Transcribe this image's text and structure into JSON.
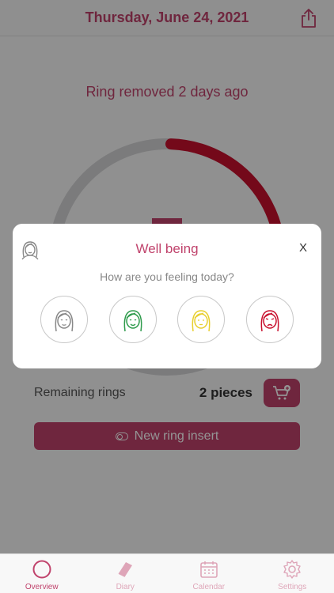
{
  "header": {
    "date": "Thursday, June 24, 2021",
    "share_icon": "share-icon"
  },
  "ring": {
    "status_text": "Ring removed 2 days ago",
    "progress_fraction": 0.28,
    "accent_color": "#c0436c",
    "progress_color": "#c8102e"
  },
  "remaining": {
    "label": "Remaining rings",
    "value": "2 pieces",
    "cart_icon": "cart-add-icon"
  },
  "new_ring": {
    "label": "New ring insert",
    "icon": "toggle-icon"
  },
  "modal": {
    "title": "Well being",
    "subtitle": "How are you feeling today?",
    "close_label": "X",
    "moods": [
      {
        "name": "neutral",
        "color": "#888888"
      },
      {
        "name": "good",
        "color": "#2e9b4c"
      },
      {
        "name": "okay",
        "color": "#e8cf2e"
      },
      {
        "name": "bad",
        "color": "#c8102e"
      }
    ]
  },
  "tabs": [
    {
      "label": "Overview",
      "icon": "ring-icon",
      "active": true
    },
    {
      "label": "Diary",
      "icon": "book-icon",
      "active": false
    },
    {
      "label": "Calendar",
      "icon": "calendar-icon",
      "active": false
    },
    {
      "label": "Settings",
      "icon": "gear-icon",
      "active": false
    }
  ]
}
